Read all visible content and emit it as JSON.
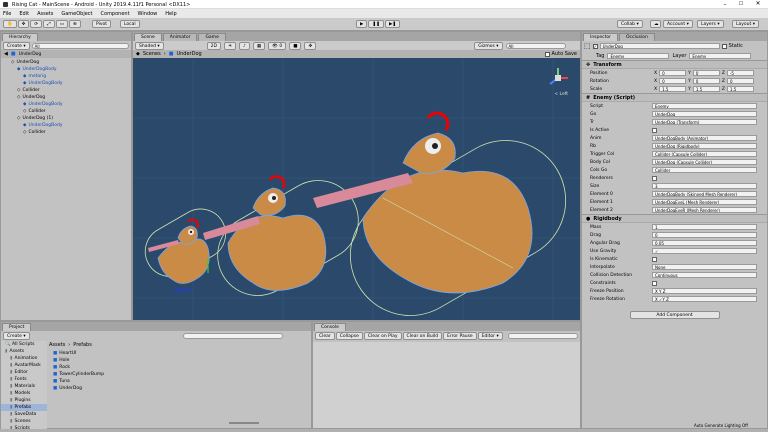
{
  "window": {
    "title": "Rising Cat - MainScene - Android - Unity 2019.4.11f1 Personal <DX11>"
  },
  "menu": [
    "File",
    "Edit",
    "Assets",
    "GameObject",
    "Component",
    "Window",
    "Help"
  ],
  "toolbar": {
    "pivot": "Pivot",
    "local": "Local",
    "collab": "Collab ▾",
    "account": "Account ▾",
    "layers": "Layers ▾",
    "layout": "Layout ▾"
  },
  "hierarchy": {
    "tab": "Hierarchy",
    "create": "Create ▾",
    "search": "All",
    "path": "UnderDog",
    "items": [
      {
        "label": "UnderDog",
        "blue": false
      },
      {
        "label": "UnderDogBody",
        "blue": true
      },
      {
        "label": "metarig",
        "blue": true
      },
      {
        "label": "UnderDogBody",
        "blue": true
      },
      {
        "label": "Collider",
        "blue": false
      },
      {
        "label": "UnderDog",
        "blue": false
      },
      {
        "label": "UnderDogBody",
        "blue": true
      },
      {
        "label": "Collider",
        "blue": false
      },
      {
        "label": "UnderDog (1)",
        "blue": false
      },
      {
        "label": "UnderDogBody",
        "blue": true
      },
      {
        "label": "Collider",
        "blue": false
      }
    ]
  },
  "scene": {
    "tabs": [
      "Scene",
      "Animator",
      "Game"
    ],
    "shading": "Shaded",
    "mode2d": "2D",
    "gizmos": "Gizmos ▾",
    "search": "All",
    "breadcrumb_a": "Scenes",
    "breadcrumb_b": "UnderDog",
    "autosave": "Auto Save",
    "persp": "< Left"
  },
  "inspector": {
    "tabs": [
      "Inspector",
      "Occlusion"
    ],
    "name": "UnderDog",
    "static": "Static",
    "tag_label": "Tag",
    "tag": "Enemy",
    "layer_label": "Layer",
    "layer": "Enemy",
    "transform": {
      "title": "Transform",
      "rows": [
        {
          "label": "Position",
          "x": "0",
          "y": "0",
          "z": "-5"
        },
        {
          "label": "Rotation",
          "x": "0",
          "y": "0",
          "z": "0"
        },
        {
          "label": "Scale",
          "x": "1.5",
          "y": "1.5",
          "z": "1.5"
        }
      ]
    },
    "enemy": {
      "title": "Enemy (Script)",
      "rows": [
        {
          "label": "Script",
          "value": "Enemy"
        },
        {
          "label": "Go",
          "value": "UnderDog"
        },
        {
          "label": "Tr",
          "value": "UnderDog (Transform)"
        },
        {
          "label": "Is Active",
          "value": ""
        },
        {
          "label": "Anim",
          "value": "UnderDogBody (Animator)"
        },
        {
          "label": "Rb",
          "value": "UnderDog (Rigidbody)"
        },
        {
          "label": "Trigger Col",
          "value": "Collider (Capsule Collider)"
        },
        {
          "label": "Body Col",
          "value": "UnderDog (Capsule Collider)"
        },
        {
          "label": "Cols Go",
          "value": "Collider"
        },
        {
          "label": "Renderers",
          "value": ""
        },
        {
          "label": "Size",
          "value": "3"
        },
        {
          "label": "Element 0",
          "value": "UnderDogBody (Skinned Mesh Renderer)"
        },
        {
          "label": "Element 1",
          "value": "UnderDogEyeL (Mesh Renderer)"
        },
        {
          "label": "Element 2",
          "value": "UnderDogEyeR (Mesh Renderer)"
        }
      ]
    },
    "rigidbody": {
      "title": "Rigidbody",
      "rows": [
        {
          "label": "Mass",
          "value": "1"
        },
        {
          "label": "Drag",
          "value": "0"
        },
        {
          "label": "Angular Drag",
          "value": "0.05"
        },
        {
          "label": "Use Gravity",
          "value": "✓"
        },
        {
          "label": "Is Kinematic",
          "value": ""
        },
        {
          "label": "Interpolate",
          "value": "None"
        },
        {
          "label": "Collision Detection",
          "value": "Continuous"
        },
        {
          "label": "Constraints",
          "value": ""
        },
        {
          "label": "Freeze Position",
          "value": "X  Y  Z"
        },
        {
          "label": "Freeze Rotation",
          "value": "X ✓Y  Z"
        }
      ]
    },
    "add_component": "Add Component"
  },
  "project": {
    "tab": "Project",
    "create": "Create ▾",
    "search": "",
    "favorites": "All Scripts",
    "tree": [
      "Assets",
      "Animation",
      "AvatarMask",
      "Editor",
      "Fonts",
      "Materials",
      "Models",
      "Plugins",
      "Prefabs",
      "SaveData",
      "Scenes",
      "Scripts"
    ],
    "path_a": "Assets",
    "path_b": "Prefabs",
    "files": [
      "HeartUI",
      "Hole",
      "Rock",
      "TowerCylinderBump",
      "Tuna",
      "UnderDog"
    ]
  },
  "console": {
    "tab": "Console",
    "buttons": [
      "Clear",
      "Collapse",
      "Clear on Play",
      "Clear on Build",
      "Error Pause",
      "Editor ▾"
    ]
  },
  "status": {
    "right": "Auto Generate Lighting Off"
  },
  "colors": {
    "scene_bg": "#2b4a6b",
    "dog": "#c98b45",
    "selection": "#6ea8ff",
    "accent": "#3d7be0"
  }
}
